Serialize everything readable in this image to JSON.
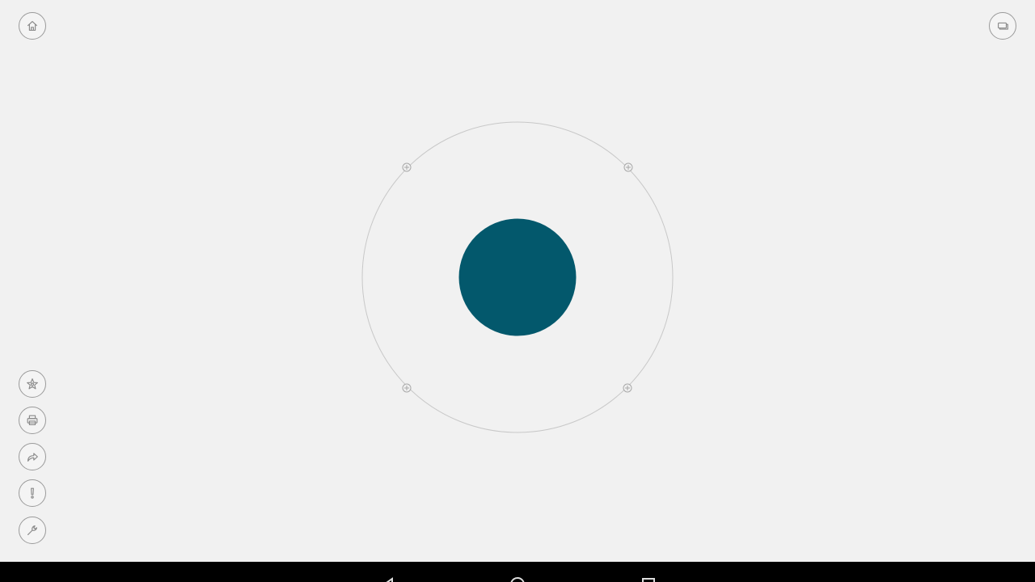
{
  "app": {
    "background_color": "#f1f1f1",
    "accent_color": "#03586c",
    "ring_color": "#c8c8c8"
  },
  "top_bar": {
    "left_icon": "home-icon",
    "right_icon": "windows-icon"
  },
  "side_toolbar": {
    "items": [
      {
        "icon": "star-icon",
        "name": "favorite"
      },
      {
        "icon": "printer-icon",
        "name": "print"
      },
      {
        "icon": "share-arrow-icon",
        "name": "share"
      },
      {
        "icon": "exclamation-icon",
        "name": "alert"
      },
      {
        "icon": "wrench-icon",
        "name": "settings"
      }
    ]
  },
  "center_widget": {
    "core_color": "#03586c",
    "handle_icon": "plus-circle-icon",
    "handle_count": 4
  },
  "system_nav": {
    "background": "#000000",
    "keys": [
      "back-icon",
      "home-circle-icon",
      "recents-square-icon"
    ]
  }
}
